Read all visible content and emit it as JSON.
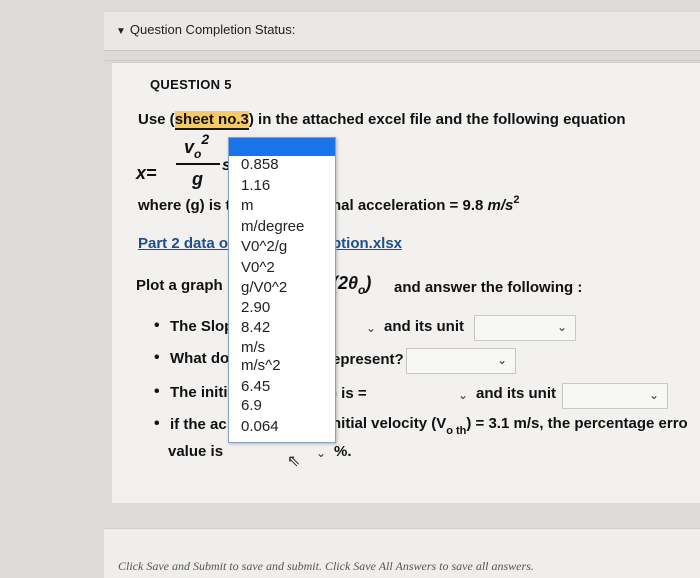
{
  "status": {
    "label": "Question Completion Status:"
  },
  "question": {
    "title": "QUESTION 5",
    "intro_prefix": "Use (",
    "sheet_ref": "sheet no.3",
    "intro_suffix": ") in the attached excel file and the following equation",
    "eq_x": "x=",
    "eq_num": "v",
    "eq_sub": "o",
    "eq_exp": "2",
    "eq_den": "g",
    "eq_s": "s",
    "where_text": "where (g) is t",
    "accel_text": "hal acceleration = 9.8",
    "accel_unit": "m/s",
    "accel_exp": "2",
    "part2_text": "Part 2 data o",
    "file_text": "ption.xlsx",
    "plot_text": "Plot a graph",
    "sin_text": "(2θ",
    "sin_sub": "o",
    "sin_close": ")",
    "answer_text": "and answer the following :",
    "b1_text": "The Slop",
    "b1_unit": "and its unit",
    "b2_text": "What do",
    "b2_rest": "epresent?",
    "b3_text": "The initi",
    "b3_is": ") is =",
    "b3_unit": "and its unit",
    "b4_text": "if the ac",
    "b4_rest": "nitial velocity (V",
    "b4_sub": "o th",
    "b4_end": ") = 3.1 m/s, the percentage erro",
    "value_text": "value is",
    "percent": "%."
  },
  "dropdown": {
    "options": [
      "0.858",
      "1.16",
      "m",
      "m/degree",
      "V0^2/g",
      "V0^2",
      "g/V0^2",
      "2.90",
      "8.42",
      "m/s",
      "m/s^2",
      "6.45",
      "6.9",
      "0.064"
    ]
  },
  "footer": {
    "text": "Click Save and Submit to save and submit. Click Save All Answers to save all answers."
  }
}
